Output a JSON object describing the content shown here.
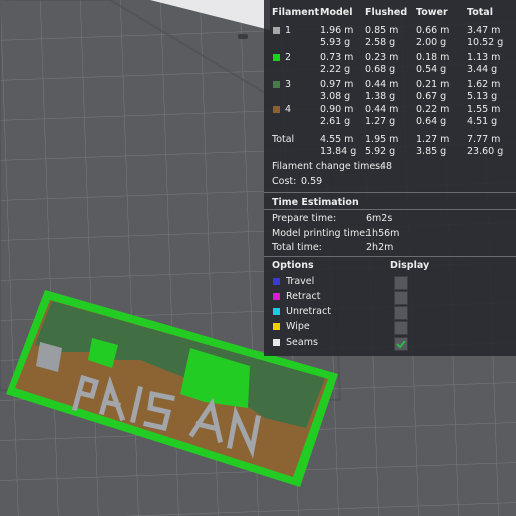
{
  "filament_table": {
    "headers": [
      "Filament",
      "Model",
      "Flushed",
      "Tower",
      "Total"
    ],
    "rows": [
      {
        "id": "1",
        "color": "#a8a8a8",
        "model": [
          "1.96 m",
          "5.93 g"
        ],
        "flushed": [
          "0.85 m",
          "2.58 g"
        ],
        "tower": [
          "0.66 m",
          "2.00 g"
        ],
        "total": [
          "3.47 m",
          "10.52 g"
        ]
      },
      {
        "id": "2",
        "color": "#1fcf1f",
        "model": [
          "0.73 m",
          "2.22 g"
        ],
        "flushed": [
          "0.23 m",
          "0.68 g"
        ],
        "tower": [
          "0.18 m",
          "0.54 g"
        ],
        "total": [
          "1.13 m",
          "3.44 g"
        ]
      },
      {
        "id": "3",
        "color": "#4a7a4a",
        "model": [
          "0.97 m",
          "3.08 g"
        ],
        "flushed": [
          "0.44 m",
          "1.38 g"
        ],
        "tower": [
          "0.21 m",
          "0.67 g"
        ],
        "total": [
          "1.62 m",
          "5.13 g"
        ]
      },
      {
        "id": "4",
        "color": "#8a6232",
        "model": [
          "0.90 m",
          "2.61 g"
        ],
        "flushed": [
          "0.44 m",
          "1.27 g"
        ],
        "tower": [
          "0.22 m",
          "0.64 g"
        ],
        "total": [
          "1.55 m",
          "4.51 g"
        ]
      }
    ],
    "total": {
      "label": "Total",
      "model": [
        "4.55 m",
        "13.84 g"
      ],
      "flushed": [
        "1.95 m",
        "5.92 g"
      ],
      "tower": [
        "1.27 m",
        "3.85 g"
      ],
      "total": [
        "7.77 m",
        "23.60 g"
      ]
    }
  },
  "filament_change": {
    "label": "Filament change times:",
    "value": "48"
  },
  "cost": {
    "label": "Cost:",
    "value": "0.59"
  },
  "time_estimation": {
    "title": "Time Estimation",
    "rows": [
      {
        "label": "Prepare time:",
        "value": "6m2s"
      },
      {
        "label": "Model printing time:",
        "value": "1h56m"
      },
      {
        "label": "Total time:",
        "value": "2h2m"
      }
    ]
  },
  "options": {
    "title": "Options",
    "display_title": "Display",
    "items": [
      {
        "label": "Travel",
        "color": "#3c3ccc",
        "checked": false
      },
      {
        "label": "Retract",
        "color": "#d020d0",
        "checked": false
      },
      {
        "label": "Unretract",
        "color": "#20c8e0",
        "checked": false
      },
      {
        "label": "Wipe",
        "color": "#f0d000",
        "checked": false
      },
      {
        "label": "Seams",
        "color": "#e8e8e8",
        "checked": true
      }
    ]
  },
  "model_text": "PAISAN",
  "colors": {
    "bed": "#5a5c60",
    "grid": "#7c7e82",
    "base_green": "#22cc22",
    "fill_brown": "#8c6434",
    "dark_green": "#426e44",
    "letters": "#9a9ea2"
  }
}
